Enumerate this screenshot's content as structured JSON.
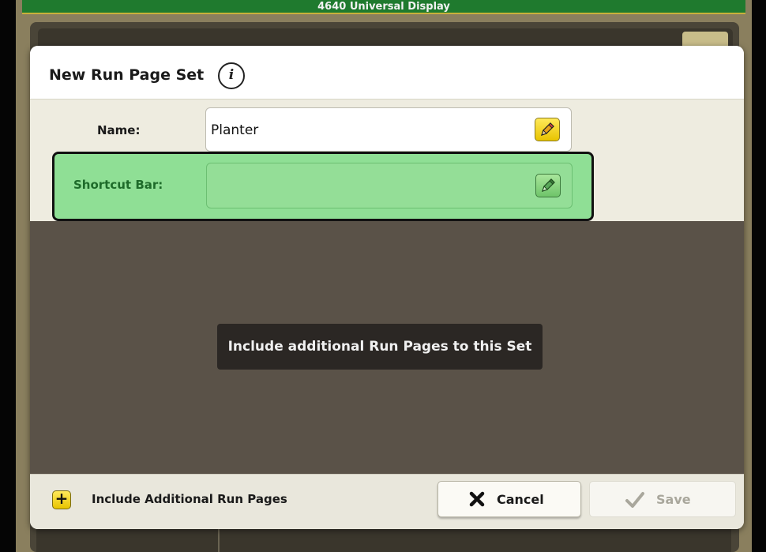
{
  "device": {
    "title": "4640 Universal Display"
  },
  "dialog": {
    "title": "New Run Page Set",
    "info_icon": "info-icon"
  },
  "form": {
    "name_label": "Name:",
    "name_value": "Planter",
    "shortcut_label": "Shortcut Bar:",
    "shortcut_value": "",
    "edit_icon": "pencil-icon"
  },
  "content": {
    "message": "Include additional Run Pages to this Set"
  },
  "footer": {
    "include_label": "Include Additional Run Pages",
    "cancel_label": "Cancel",
    "save_label": "Save"
  },
  "colors": {
    "top_bar": "#1f7a2e",
    "accent_yellow": "#ffde00",
    "highlight_green": "#8fdf95",
    "content_bg": "#5a5248"
  }
}
